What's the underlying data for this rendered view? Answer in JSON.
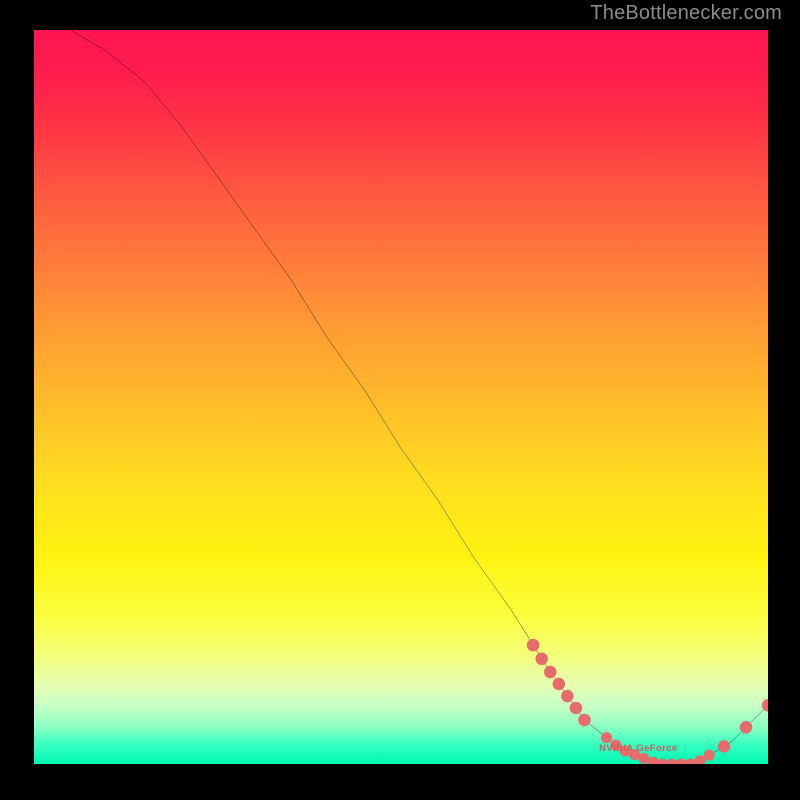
{
  "attribution": "TheBottlenecker.com",
  "chart_data": {
    "type": "line",
    "title": "",
    "xlabel": "",
    "ylabel": "",
    "xlim": [
      0,
      100
    ],
    "ylim": [
      0,
      100
    ],
    "series": [
      {
        "name": "curve",
        "x": [
          5,
          10,
          15,
          20,
          25,
          30,
          35,
          40,
          45,
          50,
          55,
          60,
          65,
          70,
          75,
          80,
          85,
          90,
          95,
          100
        ],
        "values": [
          100,
          97,
          93,
          87,
          80,
          73,
          66,
          58,
          51,
          43,
          36,
          28,
          21,
          13,
          6,
          2,
          0,
          0,
          3,
          8
        ]
      }
    ],
    "marker_clusters": [
      {
        "name": "cluster-a",
        "approx_x_range": [
          68,
          75
        ],
        "approx_y_range": [
          6,
          13
        ],
        "description": "points along descending segment"
      },
      {
        "name": "cluster-b",
        "approx_x_range": [
          78,
          92
        ],
        "approx_y_range": [
          0,
          2
        ],
        "description": "points along trough"
      },
      {
        "name": "cluster-c",
        "approx_x_range": [
          94,
          100
        ],
        "approx_y_range": [
          3,
          8
        ],
        "description": "points on rising tail"
      }
    ],
    "trough_label": {
      "text": "NVIDIA GeForce",
      "approx_x": 85,
      "approx_y": 1
    },
    "colors": {
      "curve": "#000000",
      "markers": "#e86b6b",
      "frame_bg": "#000000"
    }
  }
}
